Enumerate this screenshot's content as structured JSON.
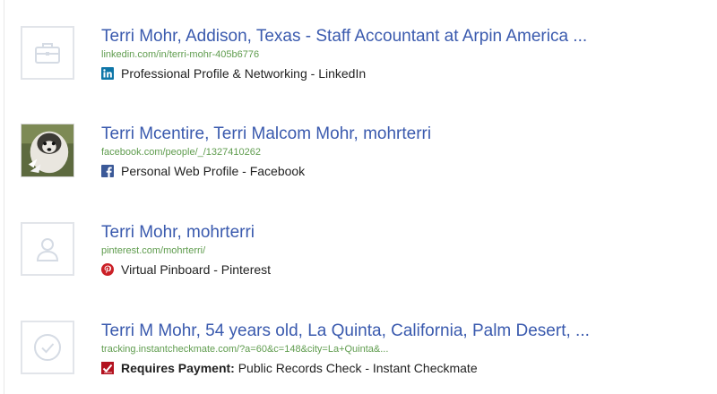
{
  "results": [
    {
      "icon": "briefcase-icon",
      "title": "Terri Mohr, Addison, Texas - Staff Accountant at Arpin America ...",
      "url": "linkedin.com/in/terri-mohr-405b6776",
      "source_icon": "linkedin-icon",
      "source": "Professional Profile & Networking - LinkedIn"
    },
    {
      "icon": "profile-photo",
      "title": "Terri Mcentire, Terri Malcom Mohr, mohrterri",
      "url": "facebook.com/people/_/1327410262",
      "source_icon": "facebook-icon",
      "source": "Personal Web Profile - Facebook"
    },
    {
      "icon": "person-icon",
      "title": "Terri Mohr, mohrterri",
      "url": "pinterest.com/mohrterri/",
      "source_icon": "pinterest-icon",
      "source": "Virtual Pinboard - Pinterest"
    },
    {
      "icon": "checkmark-circle-icon",
      "title": "Terri M Mohr, 54 years old, La Quinta, California, Palm Desert, ...",
      "url": "tracking.instantcheckmate.com/?a=60&c=148&city=La+Quinta&...",
      "source_icon": "instantcheckmate-icon",
      "source_prefix": "Requires Payment:",
      "source": " Public Records Check - Instant Checkmate"
    }
  ],
  "colors": {
    "title": "#3a5aae",
    "url": "#5f9c4e",
    "linkedin": "#0e76a8",
    "facebook": "#3b5998",
    "pinterest": "#cb2027",
    "instantcheckmate": "#b3121f"
  }
}
